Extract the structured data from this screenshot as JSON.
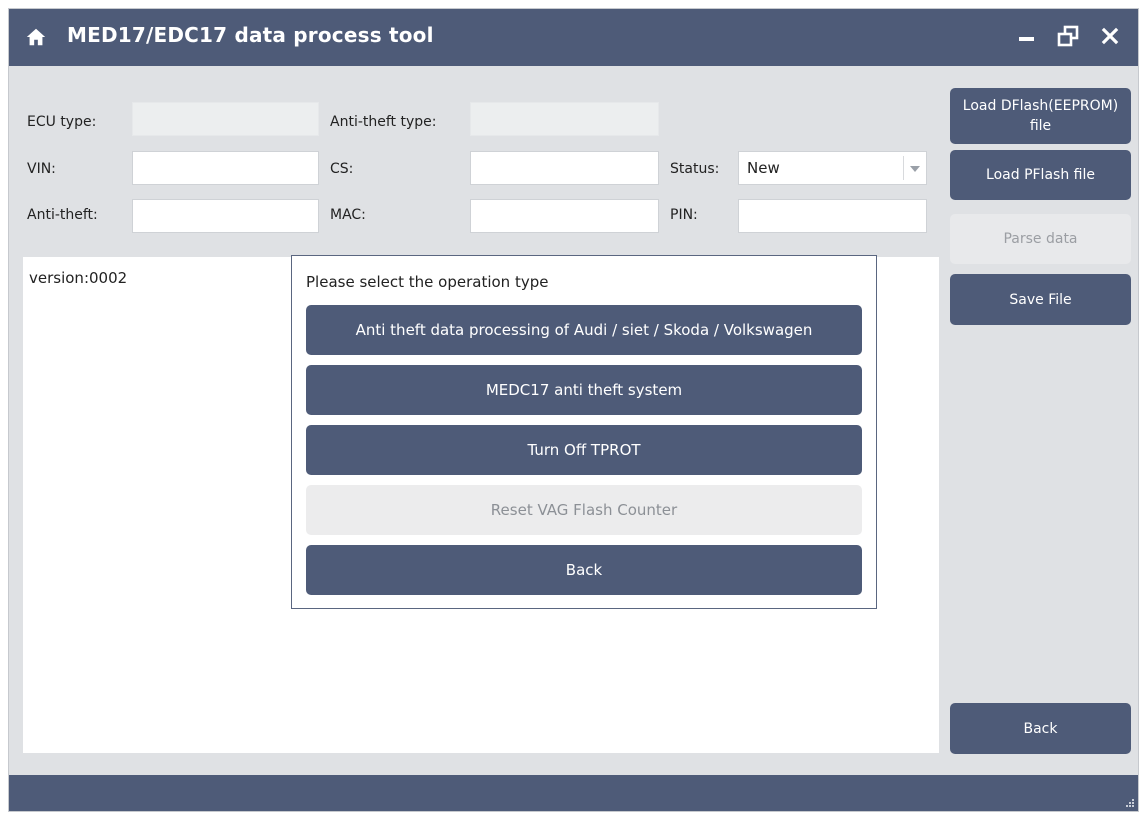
{
  "window": {
    "title": "MED17/EDC17 data process tool"
  },
  "form": {
    "ecu_type_label": "ECU type:",
    "ecu_type_value": "",
    "anti_theft_type_label": "Anti-theft type:",
    "anti_theft_type_value": "",
    "vin_label": "VIN:",
    "vin_value": "",
    "cs_label": "CS:",
    "cs_value": "",
    "status_label": "Status:",
    "status_value": "New",
    "anti_theft_label": "Anti-theft:",
    "anti_theft_value": "",
    "mac_label": "MAC:",
    "mac_value": "",
    "pin_label": "PIN:",
    "pin_value": ""
  },
  "sidebar": {
    "load_dflash": "Load DFlash(EEPROM) file",
    "load_pflash": "Load PFlash file",
    "parse_data": "Parse data",
    "save_file": "Save File",
    "back": "Back"
  },
  "log": {
    "text": "version:0002"
  },
  "dialog": {
    "prompt": "Please select the operation type",
    "options": [
      {
        "label": "Anti theft data processing of Audi / siet / Skoda / Volkswagen",
        "enabled": true
      },
      {
        "label": "MEDC17 anti theft system",
        "enabled": true
      },
      {
        "label": "Turn Off TPROT",
        "enabled": true
      },
      {
        "label": "Reset VAG Flash Counter",
        "enabled": false
      },
      {
        "label": "Back",
        "enabled": true
      }
    ]
  },
  "icons": {
    "home": "home-icon",
    "minimize": "minimize-icon",
    "restore": "restore-icon",
    "close": "close-icon",
    "status_caret": "chevron-down-icon",
    "resize_grip": "resize-grip-icon"
  },
  "colors": {
    "accent": "#4e5b78",
    "background": "#dfe1e4",
    "disabled_bg": "#e8e9eb",
    "disabled_text": "#9b9ea3"
  }
}
